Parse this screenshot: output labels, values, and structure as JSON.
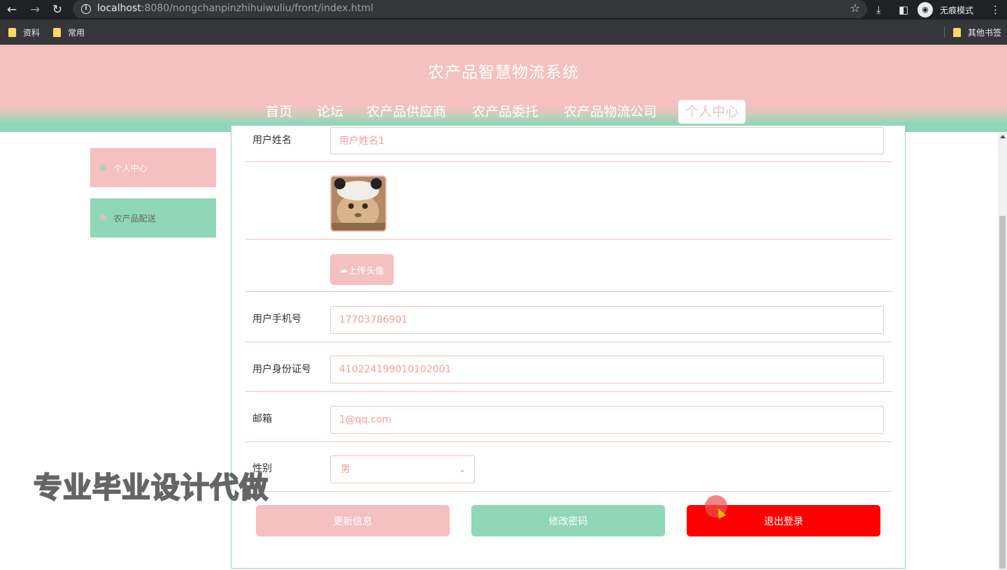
{
  "browser": {
    "url_host": "localhost",
    "url_rest": ":8080/nongchanpinzhihuiwuliu/front/index.html",
    "incognito_label": "无痕模式",
    "bookmarks": [
      "资料",
      "常用"
    ],
    "other_bookmarks": "其他书签"
  },
  "site": {
    "title": "农产品智慧物流系统",
    "nav": [
      "首页",
      "论坛",
      "农产品供应商",
      "农产品委托",
      "农产品物流公司",
      "个人中心"
    ],
    "active_nav": "个人中心"
  },
  "sidebar": {
    "items": [
      {
        "label": "个人中心",
        "icon": "snowflake-icon"
      },
      {
        "label": "农产品配送",
        "icon": "snowflake-icon"
      }
    ]
  },
  "form": {
    "name_label": "用户姓名",
    "name_value": "用户姓名1",
    "upload_label": "上传头像",
    "phone_label": "用户手机号",
    "phone_value": "17703786901",
    "idcard_label": "用户身份证号",
    "idcard_value": "410224199010102001",
    "email_label": "邮箱",
    "email_value": "1@qq.com",
    "gender_label": "性别",
    "gender_value": "男"
  },
  "actions": {
    "update": "更新信息",
    "password": "修改密码",
    "logout": "退出登录"
  },
  "overlay": {
    "watermark": "专业毕业设计代做"
  },
  "colors": {
    "pink": "#f4c0c0",
    "green": "#8fd7b8",
    "red": "#ff0000"
  }
}
